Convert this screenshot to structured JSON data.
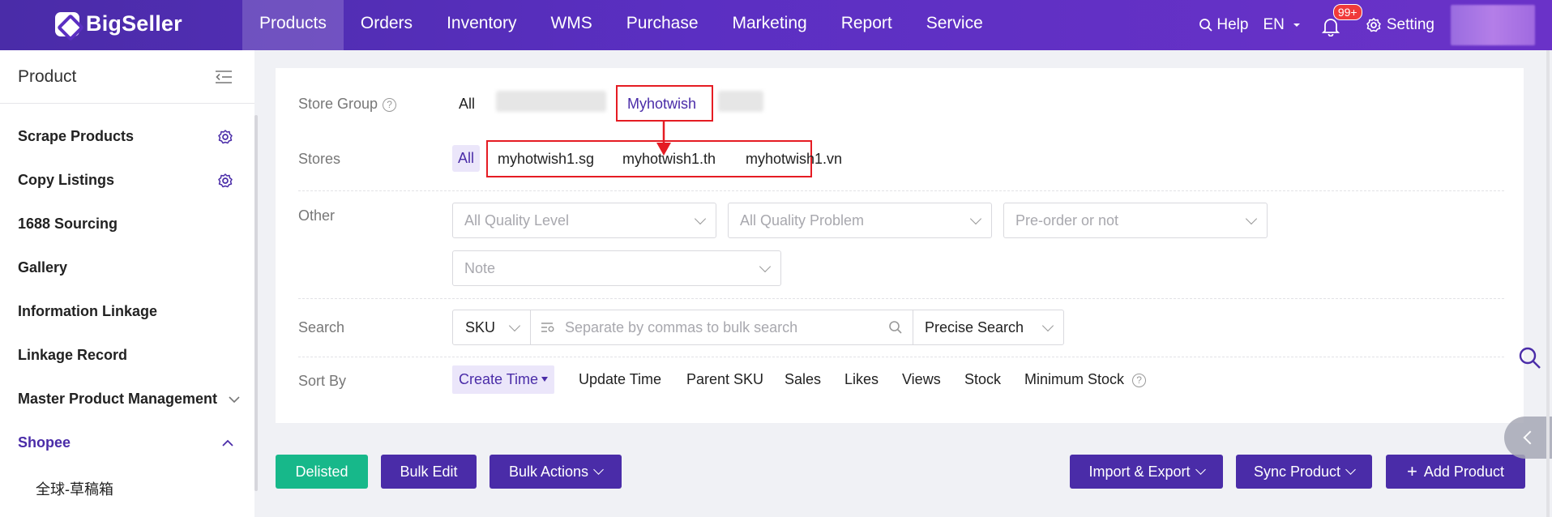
{
  "header": {
    "logo": "BigSeller",
    "nav": [
      "Products",
      "Orders",
      "Inventory",
      "WMS",
      "Purchase",
      "Marketing",
      "Report",
      "Service"
    ],
    "active_nav": "Products",
    "help": "Help",
    "lang": "EN",
    "notif_count": "99+",
    "setting": "Setting"
  },
  "sidebar": {
    "title": "Product",
    "items": [
      "Scrape Products",
      "Copy Listings",
      "1688 Sourcing",
      "Gallery",
      "Information Linkage",
      "Linkage Record",
      "Master Product Management",
      "Shopee"
    ],
    "sub_items": [
      "全球-草稿箱"
    ]
  },
  "filters": {
    "store_group_label": "Store Group",
    "store_group_all": "All",
    "store_group_selected": "Myhotwish",
    "stores_label": "Stores",
    "stores_all": "All",
    "stores": [
      "myhotwish1.sg",
      "myhotwish1.th",
      "myhotwish1.vn"
    ],
    "other_label": "Other",
    "other_selects": [
      "All Quality Level",
      "All Quality Problem",
      "Pre-order or not",
      "Note"
    ],
    "search_label": "Search",
    "search_field": "SKU",
    "search_placeholder": "Separate by commas to bulk search",
    "search_mode": "Precise Search",
    "sort_label": "Sort By",
    "sort_options": [
      "Create Time",
      "Update Time",
      "Parent SKU",
      "Sales",
      "Likes",
      "Views",
      "Stock",
      "Minimum Stock"
    ],
    "sort_active": "Create Time"
  },
  "actions": {
    "delisted": "Delisted",
    "bulk_edit": "Bulk Edit",
    "bulk_actions": "Bulk Actions",
    "import_export": "Import & Export",
    "sync_product": "Sync Product",
    "add_product": "Add Product"
  },
  "colors": {
    "brand": "#4a2ca8",
    "success": "#17b88a",
    "highlight": "#e51c23"
  }
}
